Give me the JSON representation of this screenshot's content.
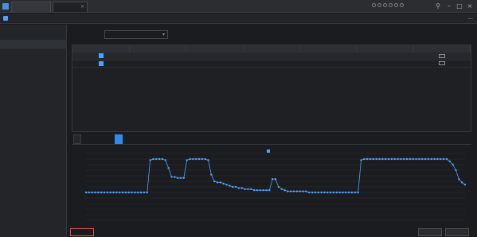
{
  "titlebar": {
    "tabs": [
      {
        "label": ""
      },
      {
        "label": ""
      }
    ],
    "window_controls": [
      "minimize-icon",
      "maximize-icon",
      "close-icon"
    ]
  },
  "subbar": {
    "breadcrumb": ""
  },
  "sidebar": {
    "items": [
      {
        "label": ""
      },
      {
        "label": ""
      },
      {
        "label": ""
      }
    ]
  },
  "form": {
    "label": "",
    "select_value": ""
  },
  "table": {
    "columns": [
      "",
      "",
      "",
      "",
      "",
      "",
      ""
    ],
    "rows": [
      {
        "checked": true,
        "cells": [
          "",
          "",
          "",
          "",
          "",
          ""
        ]
      },
      {
        "checked": true,
        "cells": [
          "",
          "",
          "",
          "",
          "",
          ""
        ]
      }
    ]
  },
  "chart_tabs": [
    {
      "label": "",
      "active": false
    },
    {
      "label": "",
      "active": true
    }
  ],
  "chart_data": {
    "type": "line",
    "title": "",
    "xlabel": "",
    "ylabel": "",
    "legend": [
      ""
    ],
    "legend_position": "top-center",
    "ylim": [
      0,
      60
    ],
    "yticks": [],
    "series": [
      {
        "name": "",
        "color": "#4da3ff",
        "values": [
          25,
          25,
          25,
          25,
          25,
          25,
          25,
          25,
          25,
          25,
          25,
          25,
          25,
          25,
          25,
          25,
          25,
          25,
          25,
          25,
          25,
          54,
          55,
          55,
          55,
          55,
          54,
          47,
          39,
          39,
          38,
          38,
          38,
          54,
          55,
          55,
          55,
          55,
          55,
          55,
          54,
          41,
          35,
          34,
          34,
          33,
          32,
          31,
          30,
          30,
          29,
          29,
          28,
          28,
          28,
          27,
          27,
          27,
          27,
          27,
          27,
          37,
          37,
          30,
          28,
          27,
          26,
          26,
          26,
          26,
          26,
          26,
          26,
          25,
          25,
          25,
          25,
          25,
          25,
          25,
          25,
          25,
          25,
          25,
          25,
          25,
          25,
          25,
          25,
          25,
          54,
          55,
          55,
          55,
          55,
          55,
          55,
          55,
          55,
          55,
          55,
          55,
          55,
          55,
          55,
          55,
          55,
          55,
          55,
          55,
          55,
          55,
          55,
          55,
          55,
          55,
          55,
          55,
          55,
          53,
          50,
          45,
          37,
          34,
          32
        ]
      }
    ]
  },
  "footer": {
    "danger_button": "",
    "buttons": [
      "",
      ""
    ]
  },
  "colors": {
    "accent": "#2e8cf0",
    "series": "#4da3ff",
    "danger": "#d9534f",
    "background": "#1b1c1f"
  }
}
